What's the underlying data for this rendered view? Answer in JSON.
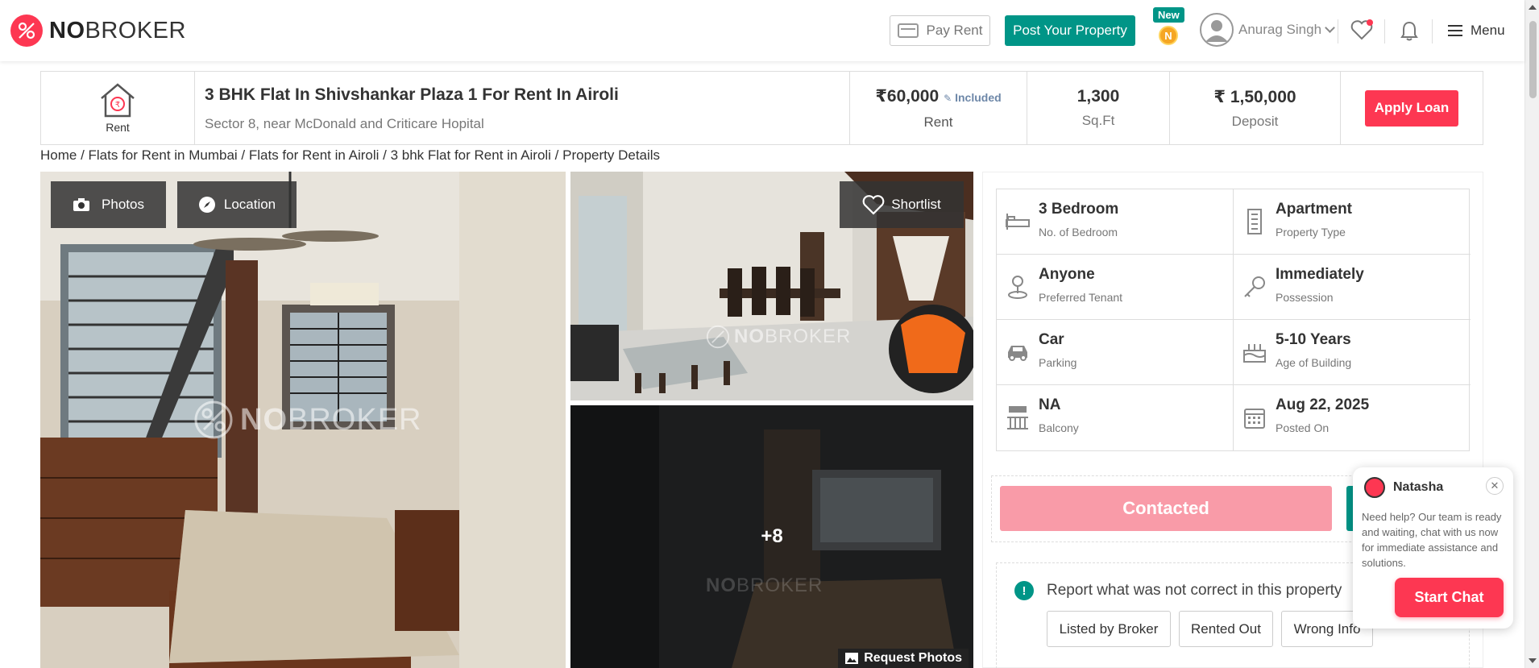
{
  "header": {
    "logo_bold": "NO",
    "logo_light": "BROKER",
    "pay_rent": "Pay Rent",
    "post_property": "Post Your Property",
    "new_badge": "New",
    "coin": "N",
    "user_name": "Anurag Singh",
    "menu": "Menu"
  },
  "summary": {
    "type_label": "Rent",
    "title": "3 BHK Flat In Shivshankar Plaza 1 For Rent In Airoli",
    "address": "Sector 8, near McDonald and Criticare Hopital",
    "rent_value": "₹60,000",
    "rent_included": "Included",
    "rent_label": "Rent",
    "area_value": "1,300",
    "area_label": "Sq.Ft",
    "deposit_value": "₹ 1,50,000",
    "deposit_label": "Deposit",
    "apply_loan": "Apply Loan"
  },
  "breadcrumb": "Home / Flats for Rent in Mumbai / Flats for Rent in Airoli / 3 bhk Flat for Rent in Airoli / Property Details",
  "gallery": {
    "photos_btn": "Photos",
    "location_btn": "Location",
    "shortlist_btn": "Shortlist",
    "more_count": "+8",
    "request_photos": "Request Photos",
    "watermark_bold": "NO",
    "watermark_light": "BROKER"
  },
  "details": [
    {
      "icon": "bed-icon",
      "value": "3 Bedroom",
      "label": "No. of Bedroom"
    },
    {
      "icon": "building-icon",
      "value": "Apartment",
      "label": "Property Type"
    },
    {
      "icon": "tenant-icon",
      "value": "Anyone",
      "label": "Preferred Tenant"
    },
    {
      "icon": "key-icon",
      "value": "Immediately",
      "label": "Possession"
    },
    {
      "icon": "car-icon",
      "value": "Car",
      "label": "Parking"
    },
    {
      "icon": "cake-icon",
      "value": "5-10 Years",
      "label": "Age of Building"
    },
    {
      "icon": "balcony-icon",
      "value": "NA",
      "label": "Balcony"
    },
    {
      "icon": "calendar-icon",
      "value": "Aug 22, 2025",
      "label": "Posted On"
    }
  ],
  "contact": {
    "contacted": "Contacted"
  },
  "report": {
    "title": "Report what was not correct in this property",
    "options": [
      "Listed by Broker",
      "Rented Out",
      "Wrong Info"
    ]
  },
  "chat": {
    "agent_name": "Natasha",
    "message": "Need help? Our team is ready and waiting, chat with us now for immediate assistance and solutions.",
    "start_chat": "Start Chat",
    "close": "✕"
  },
  "colors": {
    "brand_red": "#fd3752",
    "brand_green": "#009587",
    "contacted_pink": "#f99ba8"
  }
}
